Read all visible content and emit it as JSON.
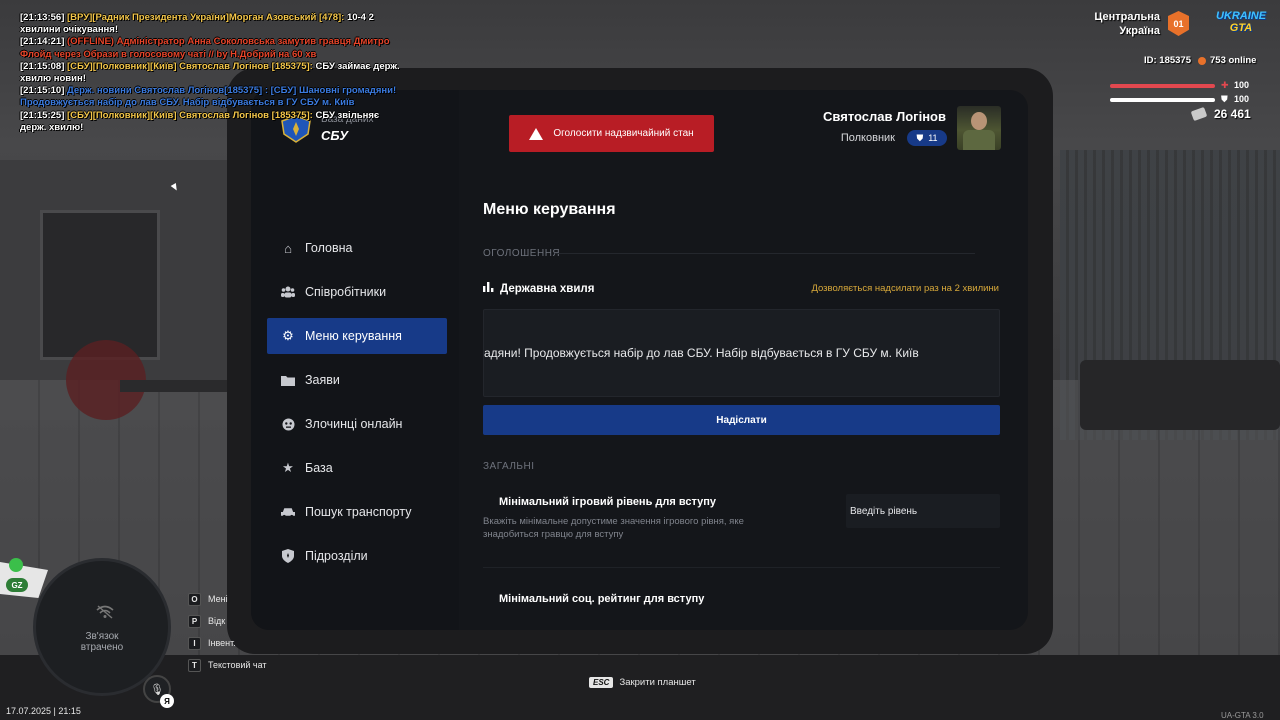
{
  "chat": [
    {
      "time": "[21:13:56]",
      "text": "[ВРУ][Радник Президента України]Морган Азовський [478]:",
      "tail": " 10-4 2 хвилини очікування!",
      "color": "#f3c64a",
      "tail_color": "#ffffff"
    },
    {
      "time": "[21:14:21]",
      "text": "(OFFLINE) Адміністратор Анна Соколовська замутив гравця Дмитро Флойд через Образи в голосовому чаті // by Н.Добрий на 60 хв",
      "tail": "",
      "color": "#e8452a",
      "tail_color": "#e8452a"
    },
    {
      "time": "[21:15:08]",
      "text": "[СБУ][Полковник][Київ] Святослав Логінов [185375]:",
      "tail": " СБУ займає держ. хвилю новин!",
      "color": "#f3c64a",
      "tail_color": "#ffffff"
    },
    {
      "time": "[21:15:10]",
      "text": "Держ. новини Святослав Логінов[185375] : [СБУ] Шановні громадяни! Продовжується набір до лав СБУ. Набір відбувається в ГУ СБУ м. Київ",
      "tail": "",
      "color": "#3b7be0",
      "tail_color": "#3b7be0"
    },
    {
      "time": "[21:15:25]",
      "text": "[СБУ][Полковник][Київ] Святослав Логінов [185375]:",
      "tail": " СБУ звільняє держ. хвилю!",
      "color": "#f3c64a",
      "tail_color": "#ffffff"
    }
  ],
  "hud": {
    "server_line1": "Центральна",
    "server_line2": "Україна",
    "server_badge": "01",
    "logo_top": "UKRAINE",
    "logo_bottom": "GTA",
    "player_id": "ID: 185375",
    "online": "753 online",
    "health": "100",
    "armor": "100",
    "money": "26 461"
  },
  "tablet": {
    "db_label": "База даних",
    "org_name": "СБУ",
    "alert_button": "Оголосити надзвичайний стан",
    "user_name": "Святослав Логінов",
    "user_rank": "Полковник",
    "rank_level": "11",
    "nav": [
      {
        "label": "Головна",
        "icon": "home-icon"
      },
      {
        "label": "Співробітники",
        "icon": "users-icon"
      },
      {
        "label": "Меню керування",
        "icon": "gear-icon",
        "active": true
      },
      {
        "label": "Заяви",
        "icon": "folder-icon"
      },
      {
        "label": "Злочинці онлайн",
        "icon": "criminal-icon"
      },
      {
        "label": "База",
        "icon": "star-icon"
      },
      {
        "label": "Пошук транспорту",
        "icon": "car-icon"
      },
      {
        "label": "Підрозділи",
        "icon": "shield-icon"
      }
    ],
    "main_title": "Меню керування",
    "section_announcements": "ОГОЛОШЕННЯ",
    "wave_label": "Державна хвиля",
    "wave_note": "Дозволяється надсилати раз на 2 хвилини",
    "wave_text": "адяни! Продовжується набір до лав СБУ. Набір відбувається в ГУ СБУ м. Київ",
    "send_button": "Надіслати",
    "section_general": "ЗАГАЛЬНІ",
    "min_level_title": "Мінімальний ігровий рівень для вступу",
    "min_level_desc": "Вкажіть мінімальне допустиме значення ігрового рівня, яке знадобиться гравцю для вступу",
    "min_level_placeholder": "Введіть рівень",
    "next_setting_title": "Мінімальний соц. рейтинг для вступу"
  },
  "minimap": {
    "status_line1": "Зв'язок",
    "status_line2": "втрачено",
    "zone": "GZ",
    "mic_badge": "Я"
  },
  "hotkeys": [
    {
      "key": "O",
      "label": "Мені"
    },
    {
      "key": "P",
      "label": "Відк"
    },
    {
      "key": "I",
      "label": "Інвент."
    },
    {
      "key": "T",
      "label": "Текстовий чат"
    }
  ],
  "esc_hint": {
    "key": "ESC",
    "label": "Закрити планшет"
  },
  "datetime": "17.07.2025 | 21:15",
  "version": "UA-GTA 3.0"
}
